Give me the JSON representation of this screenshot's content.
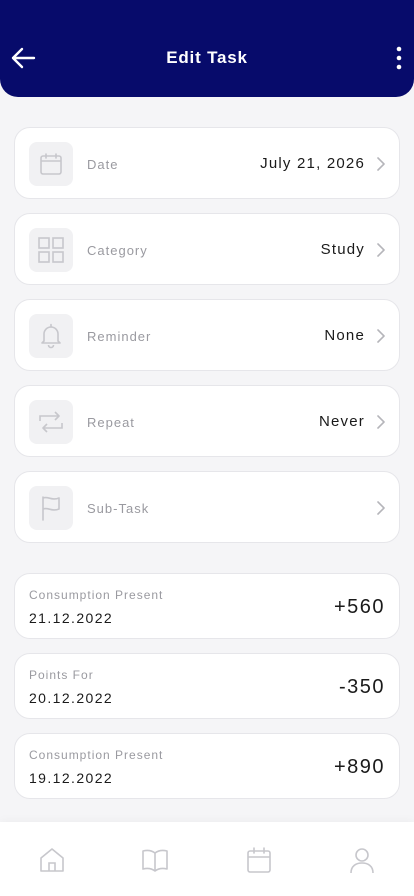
{
  "header": {
    "title": "Edit Task"
  },
  "fields": [
    {
      "label": "Date",
      "value": "July 21, 2026",
      "icon": "calendar-icon"
    },
    {
      "label": "Category",
      "value": "Study",
      "icon": "grid-icon"
    },
    {
      "label": "Reminder",
      "value": "None",
      "icon": "bell-icon"
    },
    {
      "label": "Repeat",
      "value": "Never",
      "icon": "repeat-icon"
    },
    {
      "label": "Sub-Task",
      "value": "",
      "icon": "flag-icon"
    }
  ],
  "history": [
    {
      "title": "Consumption Present",
      "date": "21.12.2022",
      "amount": "+560"
    },
    {
      "title": "Points For",
      "date": "20.12.2022",
      "amount": "-350"
    },
    {
      "title": "Consumption Present",
      "date": "19.12.2022",
      "amount": "+890"
    }
  ],
  "nav": [
    "home-icon",
    "book-icon",
    "calendar-icon",
    "profile-icon"
  ],
  "colors": {
    "header_bg": "#070b6b",
    "icon_gray": "#c7c7cc"
  }
}
